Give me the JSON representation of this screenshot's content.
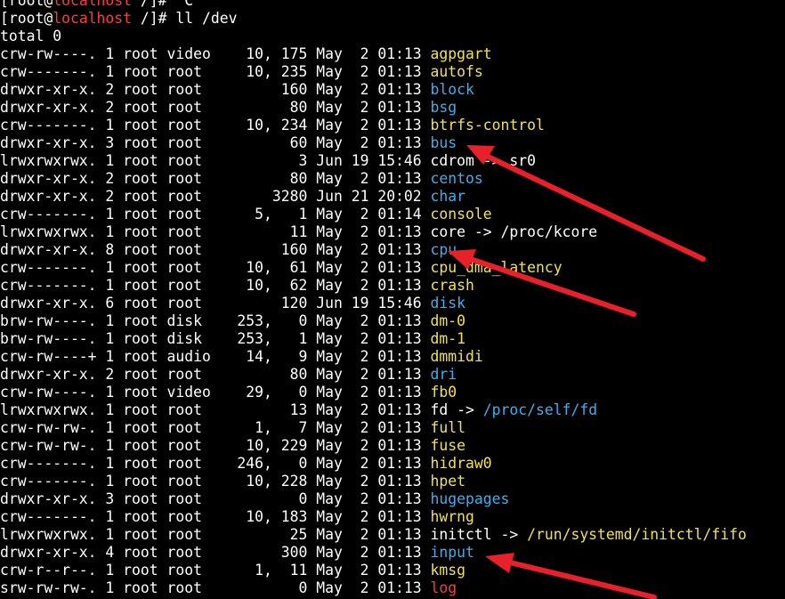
{
  "terminal": {
    "prompt_user": "[root@",
    "prompt_host": "localhost",
    "prompt_tail": " /]# ",
    "interrupt": "^C",
    "command": "ll /dev",
    "total_line": "total 0",
    "listing": [
      {
        "meta": "crw-rw----. 1 root video    10, 175 May  2 01:13 ",
        "name": "agpgart",
        "kind": "yellow"
      },
      {
        "meta": "crw-------. 1 root root     10, 235 May  2 01:13 ",
        "name": "autofs",
        "kind": "yellow"
      },
      {
        "meta": "drwxr-xr-x. 2 root root         160 May  2 01:13 ",
        "name": "block",
        "kind": "blue"
      },
      {
        "meta": "drwxr-xr-x. 2 root root          80 May  2 01:13 ",
        "name": "bsg",
        "kind": "blue"
      },
      {
        "meta": "crw-------. 1 root root     10, 234 May  2 01:13 ",
        "name": "btrfs-control",
        "kind": "yellow"
      },
      {
        "meta": "drwxr-xr-x. 3 root root          60 May  2 01:13 ",
        "name": "bus",
        "kind": "blue"
      },
      {
        "meta": "lrwxrwxrwx. 1 root root           3 Jun 19 15:46 ",
        "name": "cdrom",
        "kind": "white",
        "arrow": " -> ",
        "target": "sr0",
        "target_kind": "white"
      },
      {
        "meta": "drwxr-xr-x. 2 root root          80 May  2 01:13 ",
        "name": "centos",
        "kind": "blue"
      },
      {
        "meta": "drwxr-xr-x. 2 root root        3280 Jun 21 20:02 ",
        "name": "char",
        "kind": "blue"
      },
      {
        "meta": "crw-------. 1 root root      5,   1 May  2 01:14 ",
        "name": "console",
        "kind": "yellow"
      },
      {
        "meta": "lrwxrwxrwx. 1 root root          11 May  2 01:13 ",
        "name": "core",
        "kind": "white",
        "arrow": " -> ",
        "target": "/proc/kcore",
        "target_kind": "white"
      },
      {
        "meta": "drwxr-xr-x. 8 root root         160 May  2 01:13 ",
        "name": "cpu",
        "kind": "blue"
      },
      {
        "meta": "crw-------. 1 root root     10,  61 May  2 01:13 ",
        "name": "cpu_dma_latency",
        "kind": "yellow"
      },
      {
        "meta": "crw-------. 1 root root     10,  62 May  2 01:13 ",
        "name": "crash",
        "kind": "yellow"
      },
      {
        "meta": "drwxr-xr-x. 6 root root         120 Jun 19 15:46 ",
        "name": "disk",
        "kind": "blue"
      },
      {
        "meta": "brw-rw----. 1 root disk    253,   0 May  2 01:13 ",
        "name": "dm-0",
        "kind": "yellow"
      },
      {
        "meta": "brw-rw----. 1 root disk    253,   1 May  2 01:13 ",
        "name": "dm-1",
        "kind": "yellow"
      },
      {
        "meta": "crw-rw----+ 1 root audio    14,   9 May  2 01:13 ",
        "name": "dmmidi",
        "kind": "yellow"
      },
      {
        "meta": "drwxr-xr-x. 2 root root          80 May  2 01:13 ",
        "name": "dri",
        "kind": "blue"
      },
      {
        "meta": "crw-rw----. 1 root video    29,   0 May  2 01:13 ",
        "name": "fb0",
        "kind": "yellow"
      },
      {
        "meta": "lrwxrwxrwx. 1 root root          13 May  2 01:13 ",
        "name": "fd",
        "kind": "white",
        "arrow": " -> ",
        "target": "/proc/self/fd",
        "target_kind": "blue"
      },
      {
        "meta": "crw-rw-rw-. 1 root root      1,   7 May  2 01:13 ",
        "name": "full",
        "kind": "yellow"
      },
      {
        "meta": "crw-rw-rw-. 1 root root     10, 229 May  2 01:13 ",
        "name": "fuse",
        "kind": "yellow"
      },
      {
        "meta": "crw-------. 1 root root    246,   0 May  2 01:13 ",
        "name": "hidraw0",
        "kind": "yellow"
      },
      {
        "meta": "crw-------. 1 root root     10, 228 May  2 01:13 ",
        "name": "hpet",
        "kind": "yellow"
      },
      {
        "meta": "drwxr-xr-x. 3 root root           0 May  2 01:13 ",
        "name": "hugepages",
        "kind": "blue"
      },
      {
        "meta": "crw-------. 1 root root     10, 183 May  2 01:13 ",
        "name": "hwrng",
        "kind": "yellow"
      },
      {
        "meta": "lrwxrwxrwx. 1 root root          25 May  2 01:13 ",
        "name": "initctl",
        "kind": "white",
        "arrow": " -> ",
        "target": "/run/systemd/initctl/fifo",
        "target_kind": "yellow"
      },
      {
        "meta": "drwxr-xr-x. 4 root root         300 May  2 01:13 ",
        "name": "input",
        "kind": "blue"
      },
      {
        "meta": "crw-r--r--. 1 root root      1,  11 May  2 01:13 ",
        "name": "kmsg",
        "kind": "yellow"
      },
      {
        "meta": "srw-rw-rw-. 1 root root           0 May  2 01:13 ",
        "name": "log",
        "kind": "red"
      }
    ]
  },
  "colors": {
    "background": "#000000",
    "text": "#ffffff",
    "device": "#f2e24a",
    "directory": "#3ab0f2",
    "socket": "#ff3b3b",
    "annotation_arrow": "#e8202a"
  }
}
